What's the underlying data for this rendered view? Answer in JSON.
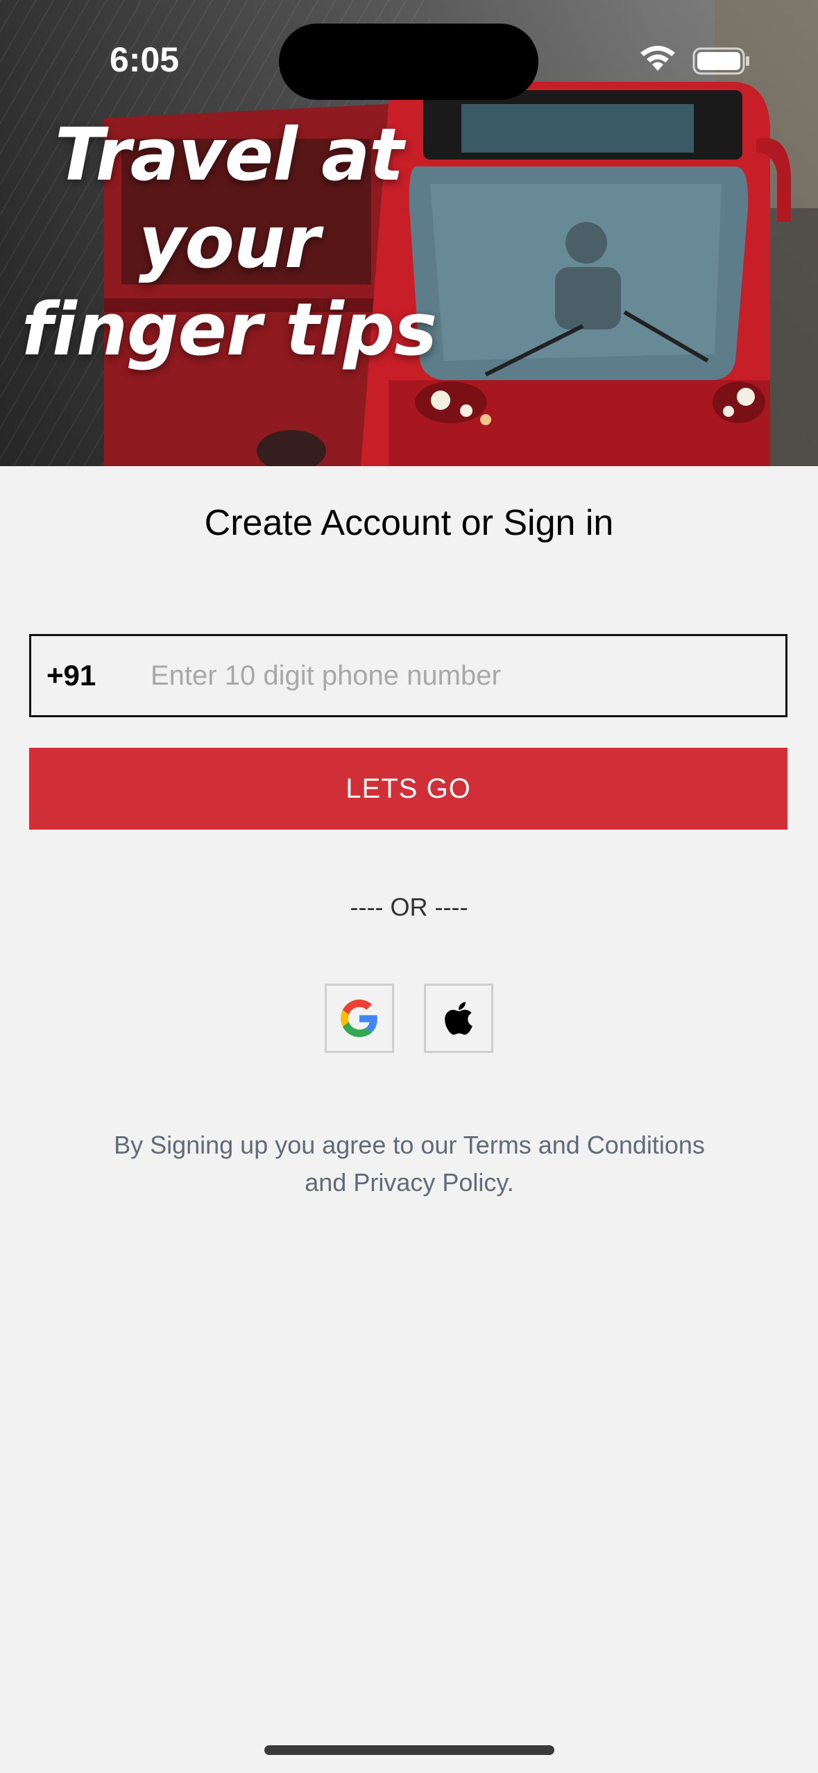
{
  "status_bar": {
    "time": "6:05"
  },
  "hero": {
    "title_lines": [
      "Travel at",
      "your",
      "finger tips"
    ],
    "background_image": "red-bus-photo"
  },
  "form": {
    "heading": "Create Account or Sign in",
    "country_code": "+91",
    "phone_placeholder": "Enter 10 digit phone number",
    "phone_value": "",
    "submit_label": "LETS GO"
  },
  "divider": "---- OR ----",
  "social": {
    "google_icon": "google-icon",
    "apple_icon": "apple-icon"
  },
  "legal": {
    "text": "By Signing up you agree to our Terms and Conditions and Privacy Policy."
  },
  "colors": {
    "accent": "#d02f38",
    "background": "#f2f2f2",
    "legal_text": "#606a78"
  }
}
